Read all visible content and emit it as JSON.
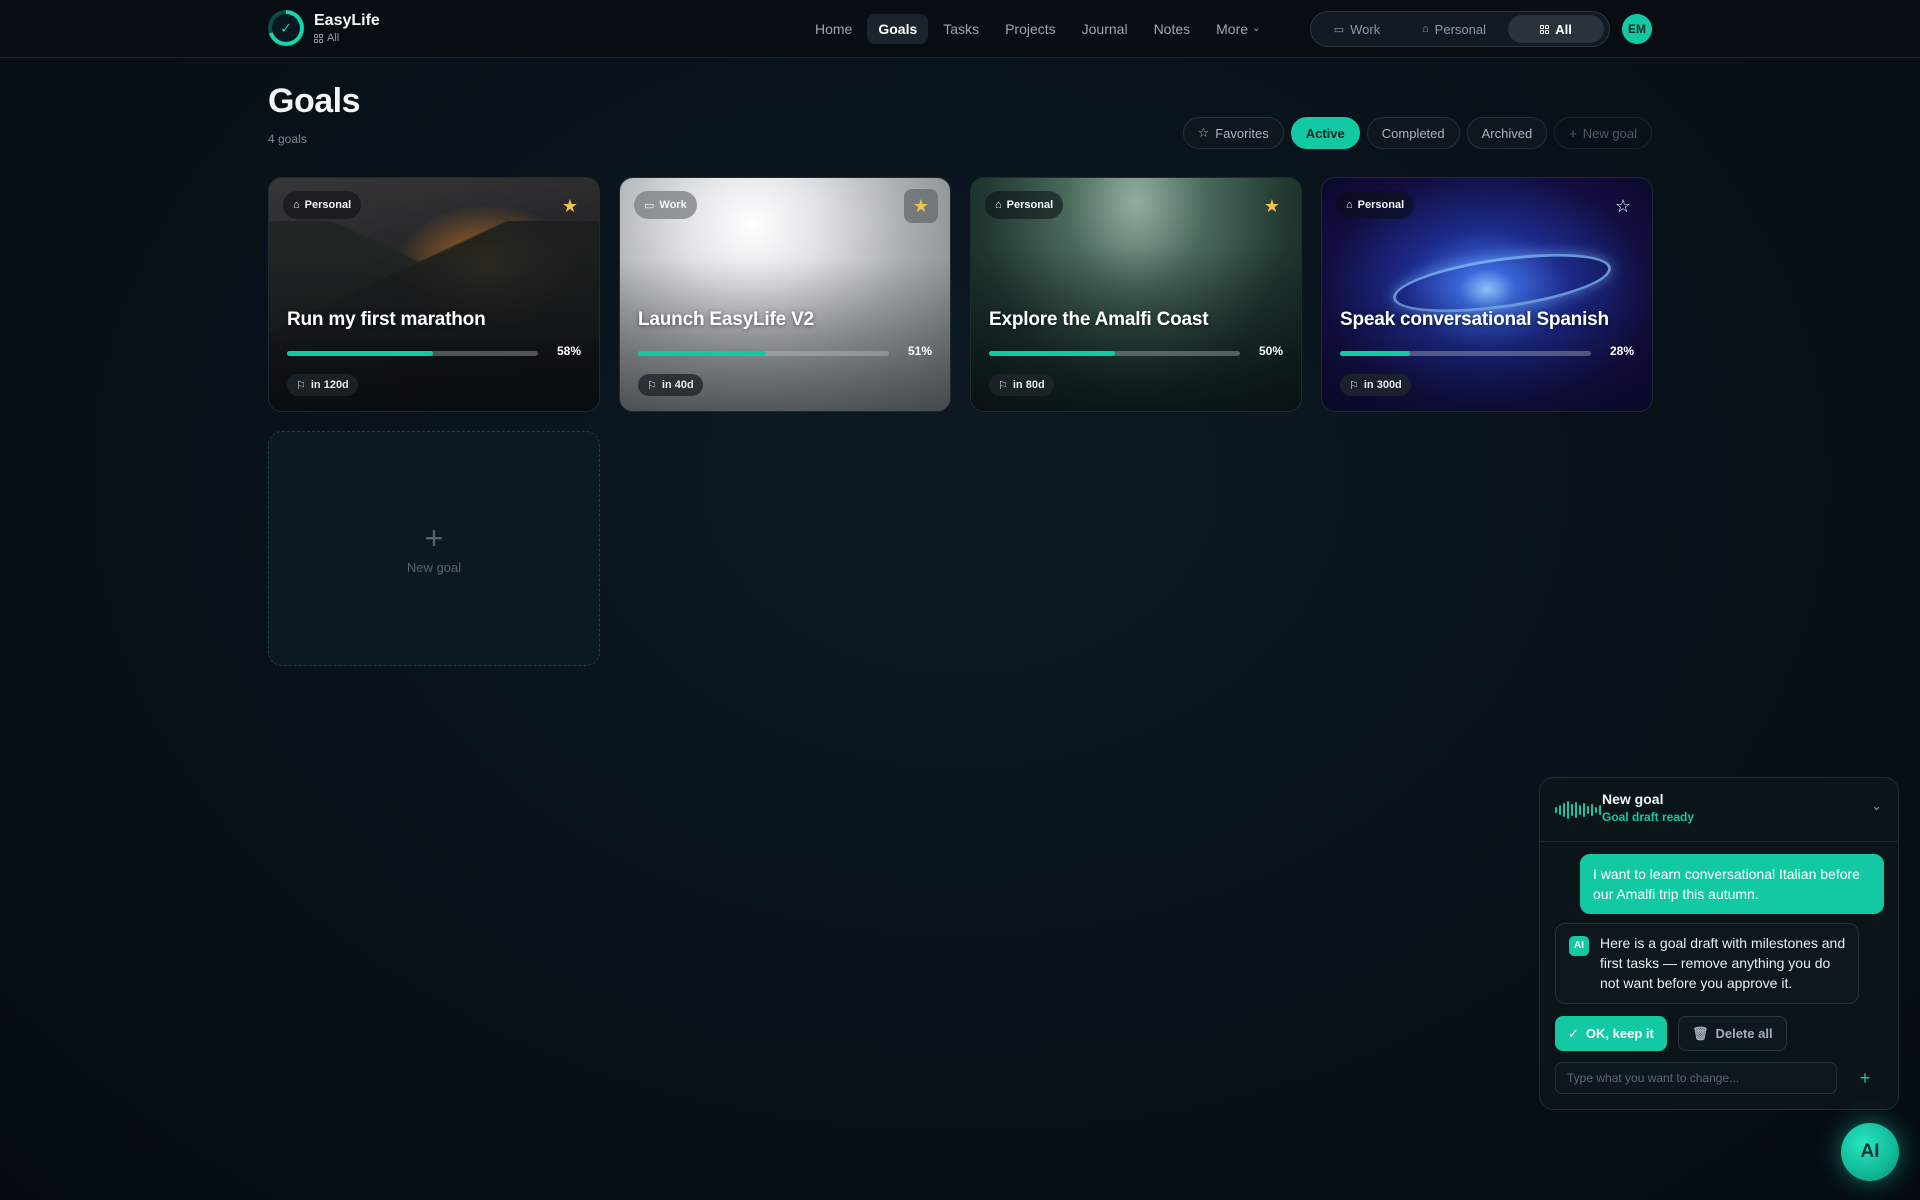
{
  "app": {
    "name": "EasyLife",
    "scope_label": "All"
  },
  "nav": {
    "items": [
      "Home",
      "Goals",
      "Tasks",
      "Projects",
      "Journal",
      "Notes"
    ],
    "active": "Goals",
    "more_label": "More"
  },
  "scope_switch": {
    "items": [
      "Work",
      "Personal",
      "All"
    ],
    "active": "All"
  },
  "user": {
    "initials": "EM"
  },
  "page": {
    "title": "Goals",
    "count": "4 goals"
  },
  "filters": {
    "favorites": "Favorites",
    "active": "Active",
    "completed": "Completed",
    "archived": "Archived",
    "new_goal": "New goal",
    "selected": "Active"
  },
  "goals": [
    {
      "category": "Personal",
      "category_icon": "home-icon",
      "title": "Run my first marathon",
      "progress": 58,
      "progress_label": "58%",
      "due": "in 120d",
      "favorite": true
    },
    {
      "category": "Work",
      "category_icon": "briefcase-icon",
      "title": "Launch EasyLife V2",
      "progress": 51,
      "progress_label": "51%",
      "due": "in 40d",
      "favorite": true
    },
    {
      "category": "Personal",
      "category_icon": "home-icon",
      "title": "Explore the Amalfi Coast",
      "progress": 50,
      "progress_label": "50%",
      "due": "in 80d",
      "favorite": true
    },
    {
      "category": "Personal",
      "category_icon": "home-icon",
      "title": "Speak conversational Spanish",
      "progress": 28,
      "progress_label": "28%",
      "due": "in 300d",
      "favorite": false
    }
  ],
  "new_goal_card": {
    "label": "New goal"
  },
  "assistant": {
    "title": "New goal",
    "status": "Goal draft ready",
    "user_message": "I want to learn conversational Italian before our Amalfi trip this autumn.",
    "ai_badge": "AI",
    "ai_message": "Here is a goal draft with milestones and first tasks — remove anything you do not want before you approve it.",
    "ok_label": "OK, keep it",
    "delete_label": "Delete all",
    "input_placeholder": "Type what you want to change...",
    "fab_label": "AI"
  },
  "colors": {
    "accent": "#12c9a3",
    "star": "#f2c14e",
    "background": "#081018"
  }
}
